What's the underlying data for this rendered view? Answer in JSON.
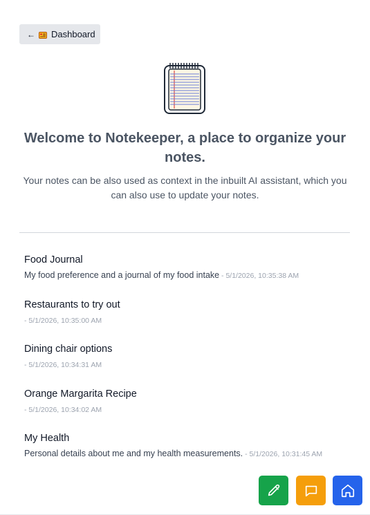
{
  "nav": {
    "back_arrow": "←",
    "back_label": "Dashboard",
    "back_icon": "dashboard-icon"
  },
  "hero": {
    "icon": "notebook-icon",
    "title": "Welcome to Notekeeper, a place to organize your notes.",
    "subtitle": "Your notes can be also used as context in the inbuilt AI assistant, which you can also use to update your notes."
  },
  "notes": [
    {
      "title": "Food Journal",
      "description": "My food preference and a journal of my food intake",
      "timestamp": " - 5/1/2026, 10:35:38 AM"
    },
    {
      "title": "Restaurants to try out",
      "description": "",
      "timestamp": "- 5/1/2026, 10:35:00 AM"
    },
    {
      "title": "Dining chair options",
      "description": "",
      "timestamp": "- 5/1/2026, 10:34:31 AM"
    },
    {
      "title": "Orange Margarita Recipe",
      "description": "",
      "timestamp": "- 5/1/2026, 10:34:02 AM"
    },
    {
      "title": "My Health",
      "description": "Personal details about me and my health measurements.",
      "timestamp": " - 5/1/2026, 10:31:45 AM"
    }
  ],
  "actions": {
    "edit_icon": "pencil-icon",
    "chat_icon": "chat-icon",
    "home_icon": "home-icon"
  },
  "colors": {
    "edit": "#16a34a",
    "chat": "#f59e0b",
    "home": "#2563eb",
    "back_bg": "#e5e7eb",
    "timestamp": "#9ca3af",
    "title": "#4b5563"
  }
}
